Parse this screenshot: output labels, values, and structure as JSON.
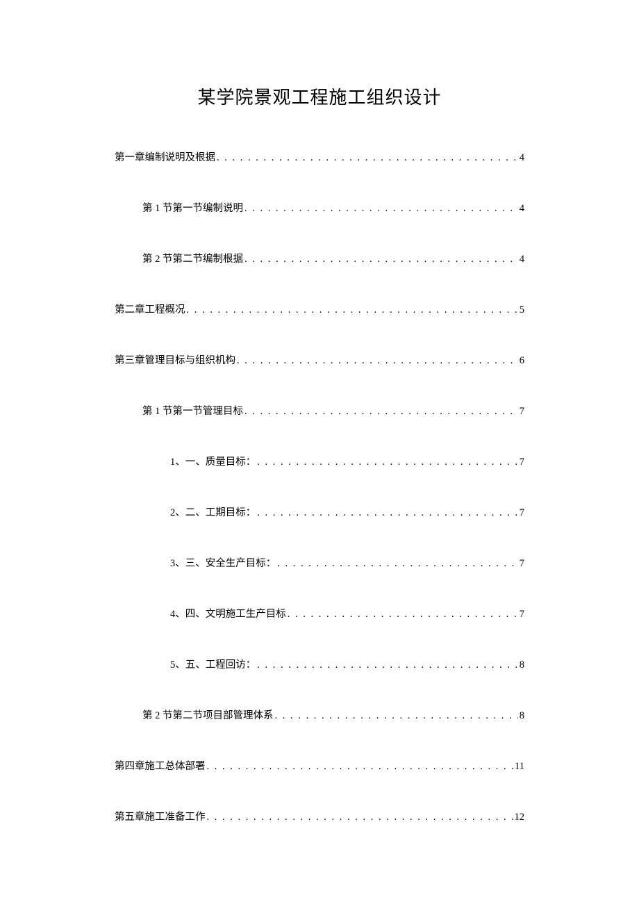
{
  "title": "某学院景观工程施工组织设计",
  "toc": [
    {
      "label": "第一章编制说明及根据",
      "page": "4",
      "level": 0
    },
    {
      "label": "第 1 节第一节编制说明",
      "page": "4",
      "level": 1
    },
    {
      "label": "第 2 节第二节编制根据",
      "page": "4",
      "level": 1
    },
    {
      "label": "第二章工程概况",
      "page": "5",
      "level": 0
    },
    {
      "label": "第三章管理目标与组织机构",
      "page": "6",
      "level": 0
    },
    {
      "label": "第 1 节第一节管理目标",
      "page": "7",
      "level": 1
    },
    {
      "label": "1、一、质量目标：",
      "page": "7",
      "level": 2
    },
    {
      "label": "2、二、工期目标：",
      "page": "7",
      "level": 2
    },
    {
      "label": "3、三、安全生产目标：",
      "page": "7",
      "level": 2
    },
    {
      "label": "4、四、文明施工生产目标",
      "page": "7",
      "level": 2
    },
    {
      "label": "5、五、工程回访：",
      "page": "8",
      "level": 2
    },
    {
      "label": "第 2 节第二节项目部管理体系",
      "page": "8",
      "level": 1
    },
    {
      "label": "第四章施工总体部署",
      "page": "11",
      "level": 0
    },
    {
      "label": "第五章施工准备工作",
      "page": "12",
      "level": 0
    }
  ]
}
